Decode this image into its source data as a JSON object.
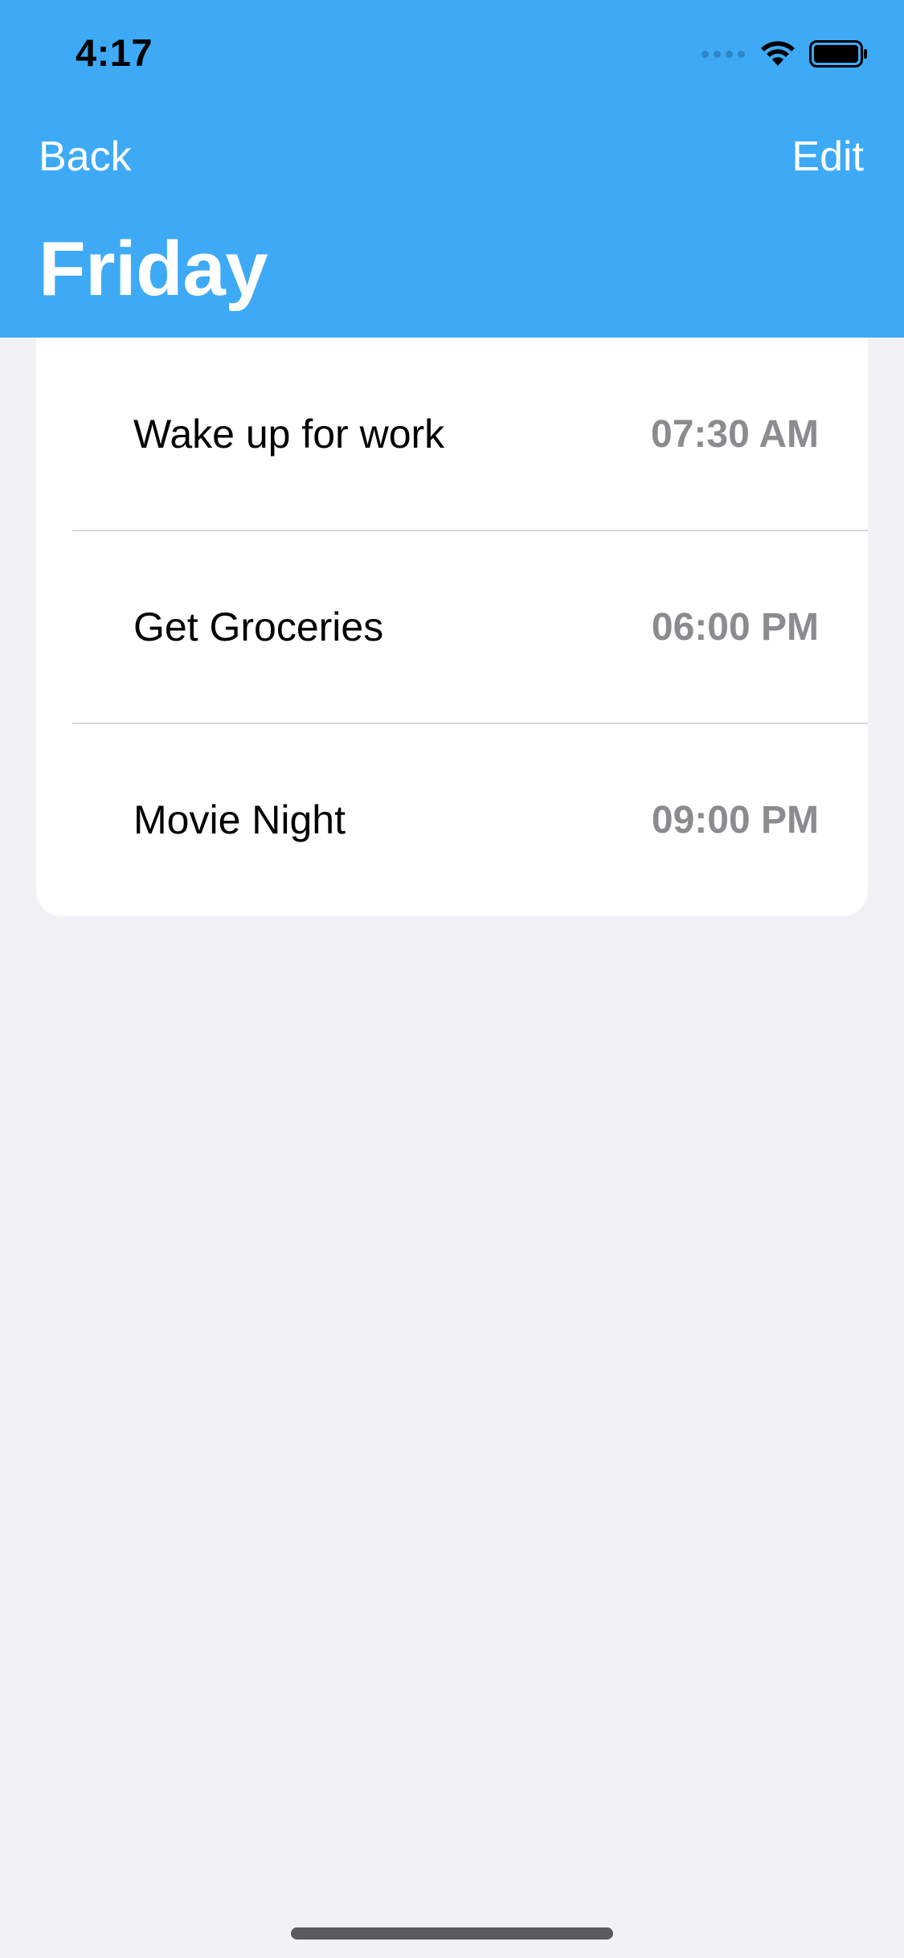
{
  "status_bar": {
    "time": "4:17",
    "icons": [
      "signal-dots-icon",
      "wifi-icon",
      "battery-icon"
    ]
  },
  "nav": {
    "back_label": "Back",
    "edit_label": "Edit",
    "title": "Friday"
  },
  "events": [
    {
      "label": "Wake up for work",
      "time": "07:30 AM"
    },
    {
      "label": "Get Groceries",
      "time": "06:00 PM"
    },
    {
      "label": "Movie Night",
      "time": "09:00 PM"
    }
  ],
  "colors": {
    "header": "#3eaaf5",
    "background": "#f1f1f6",
    "time_text": "#8b8b90"
  }
}
